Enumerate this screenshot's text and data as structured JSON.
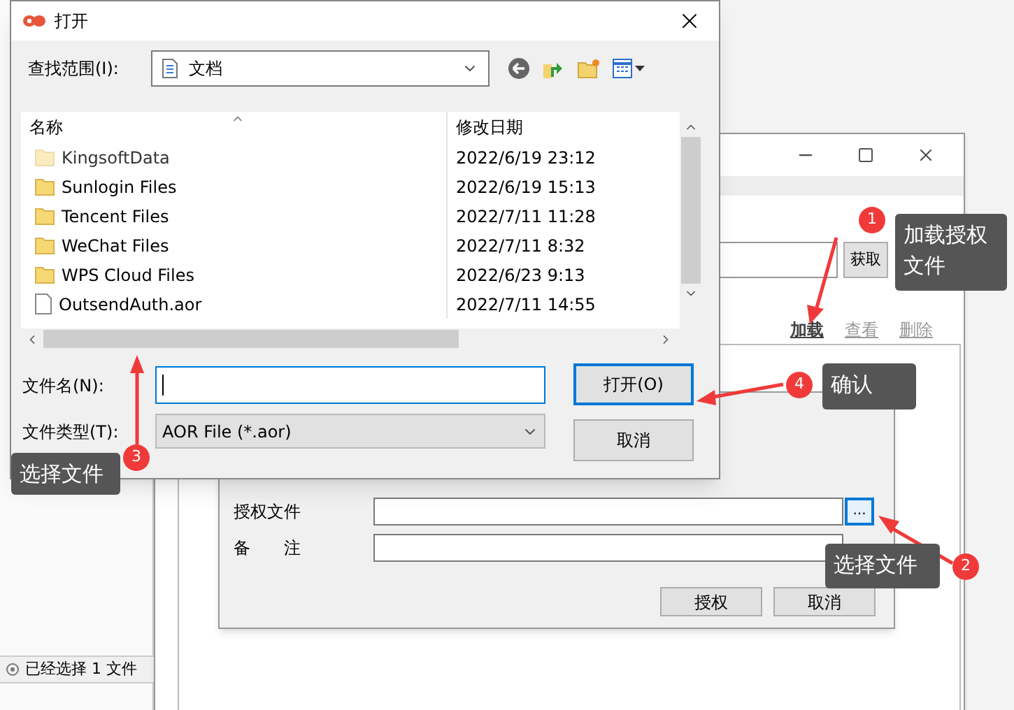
{
  "main_window": {
    "fetch_button": "获取",
    "links": [
      {
        "label": "加载",
        "disabled": false
      },
      {
        "label": "查看",
        "disabled": true
      },
      {
        "label": "删除",
        "disabled": true
      }
    ],
    "status_text": "已经选择 1 文件"
  },
  "auth_dialog": {
    "fields": [
      {
        "label": "授权文件",
        "kind": "file"
      },
      {
        "label": "备　　注",
        "kind": "text"
      }
    ],
    "browse_button": "...",
    "buttons": [
      "授权",
      "取消"
    ]
  },
  "open_dialog": {
    "title": "打开",
    "look_in_label": "查找范围(I):",
    "look_in_value": "文档",
    "columns": [
      "名称",
      "修改日期"
    ],
    "rows": [
      {
        "name": "KingsoftData",
        "date": "2022/6/19 23:12",
        "kind": "folder",
        "hidden": true
      },
      {
        "name": "Sunlogin Files",
        "date": "2022/6/19 15:13",
        "kind": "folder",
        "hidden": false
      },
      {
        "name": "Tencent Files",
        "date": "2022/7/11 11:28",
        "kind": "folder",
        "hidden": false
      },
      {
        "name": "WeChat Files",
        "date": "2022/7/11 8:32",
        "kind": "folder",
        "hidden": false
      },
      {
        "name": "WPS Cloud Files",
        "date": "2022/6/23 9:13",
        "kind": "folder",
        "hidden": false
      },
      {
        "name": "OutsendAuth.aor",
        "date": "2022/7/11 14:55",
        "kind": "file",
        "hidden": false
      }
    ],
    "file_name_label": "文件名(N):",
    "file_type_label": "文件类型(T):",
    "file_type_value": "AOR File (*.aor)",
    "buttons": [
      {
        "label": "打开(O)",
        "default": true
      },
      {
        "label": "取消",
        "default": false
      }
    ]
  },
  "annotations": [
    {
      "number": "1",
      "text": "加载授权文件"
    },
    {
      "number": "2",
      "text": "选择文件"
    },
    {
      "number": "3",
      "text": "选择文件"
    },
    {
      "number": "4",
      "text": "确认"
    }
  ]
}
